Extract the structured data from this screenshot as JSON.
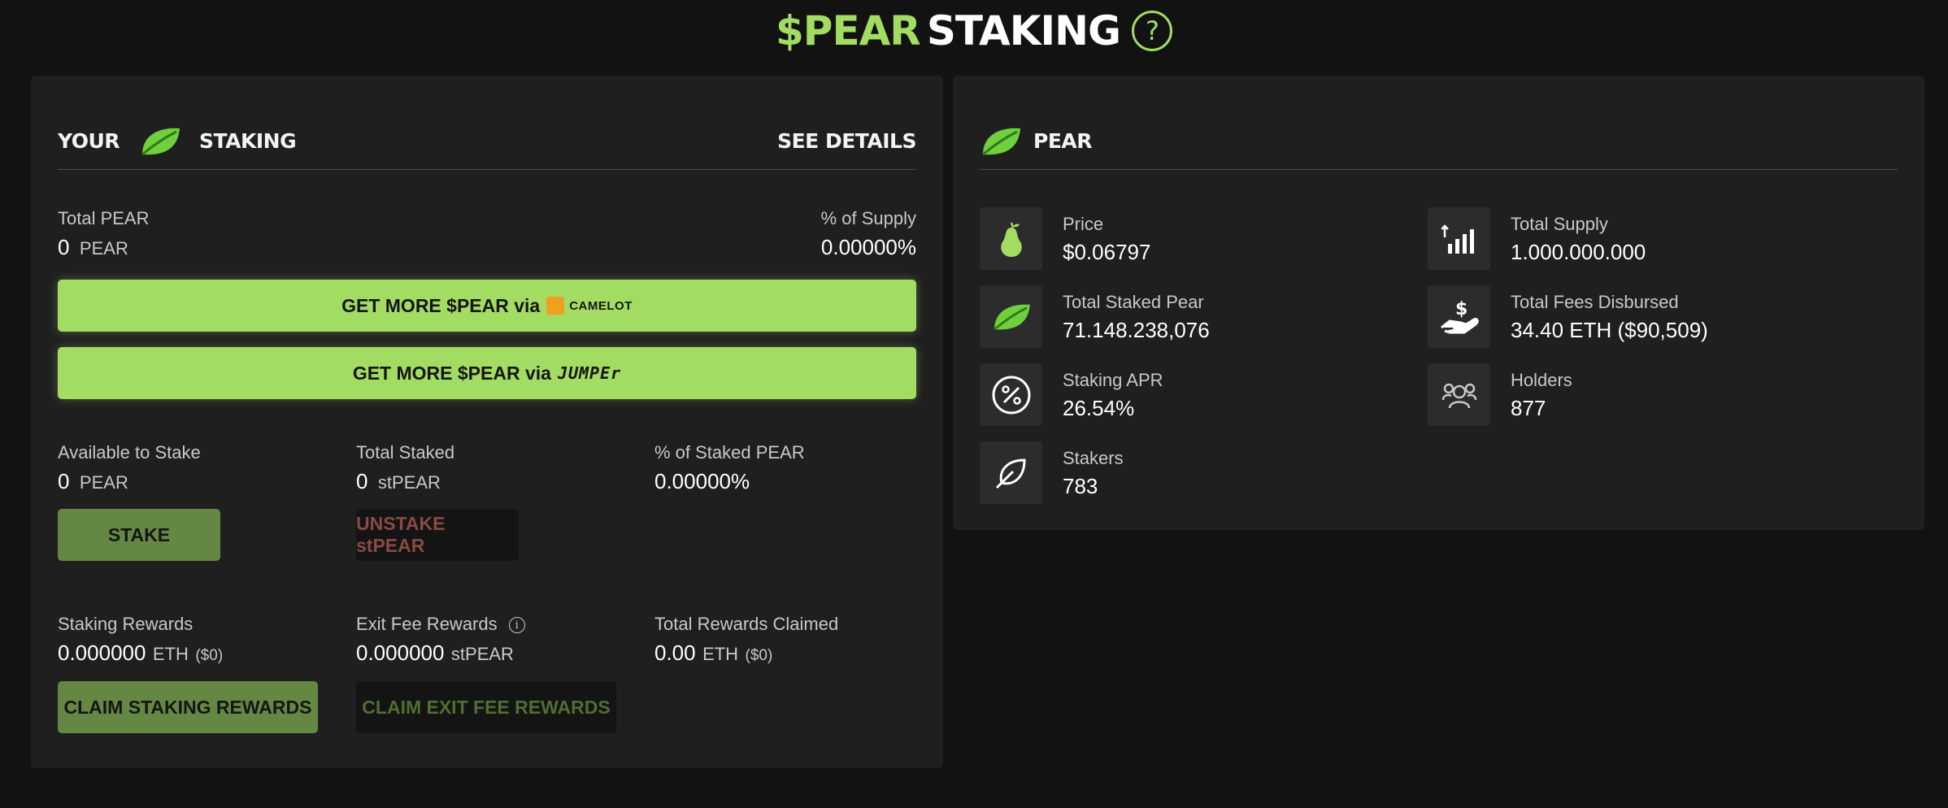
{
  "header": {
    "title_green": "$PEAR",
    "title_white": "STAKING"
  },
  "staking": {
    "your": "YOUR",
    "staking": "STAKING",
    "see_details": "SEE DETAILS",
    "total_pear_label": "Total PEAR",
    "total_pear_value": "0",
    "total_pear_unit": "PEAR",
    "supply_label": "% of Supply",
    "supply_value": "0.00000%",
    "btn_camelot_text": "GET MORE $PEAR via",
    "camelot_name": "CAMELOT",
    "btn_jumper_text": "GET MORE $PEAR via",
    "jumper_name": "JUMPEr",
    "available_label": "Available to Stake",
    "available_value": "0",
    "available_unit": "PEAR",
    "total_staked_label": "Total Staked",
    "total_staked_value": "0",
    "total_staked_unit": "stPEAR",
    "pct_staked_label": "% of Staked PEAR",
    "pct_staked_value": "0.00000%",
    "stake_btn": "STAKE",
    "unstake_btn": "UNSTAKE stPEAR",
    "staking_rewards_label": "Staking Rewards",
    "staking_rewards_value": "0.000000",
    "staking_rewards_unit": "ETH",
    "staking_rewards_usd": "($0)",
    "exit_fee_label": "Exit Fee Rewards",
    "exit_fee_value": "0.000000",
    "exit_fee_unit": "stPEAR",
    "total_claimed_label": "Total Rewards Claimed",
    "total_claimed_value": "0.00",
    "total_claimed_unit": "ETH",
    "total_claimed_usd": "($0)",
    "claim_staking_btn": "CLAIM STAKING REWARDS",
    "claim_exit_btn": "CLAIM EXIT FEE REWARDS"
  },
  "pear": {
    "title": "PEAR",
    "price_label": "Price",
    "price_value": "$0.06797",
    "supply_label": "Total Supply",
    "supply_value": "1.000.000.000",
    "staked_label": "Total Staked Pear",
    "staked_value": "71.148.238,076",
    "fees_label": "Total Fees Disbursed",
    "fees_value": "34.40 ETH ($90,509)",
    "apr_label": "Staking APR",
    "apr_value": "26.54%",
    "holders_label": "Holders",
    "holders_value": "877",
    "stakers_label": "Stakers",
    "stakers_value": "783"
  },
  "colors": {
    "accent": "#a3dc63",
    "panel": "#1f1f1f",
    "background": "#121212"
  },
  "icons": [
    "help-icon",
    "leaf-icon",
    "camelot-logo",
    "jumper-logo",
    "info-icon",
    "pear-icon",
    "chart-up-icon",
    "hand-dollar-icon",
    "percent-icon",
    "users-icon",
    "leaf-outline-icon"
  ]
}
